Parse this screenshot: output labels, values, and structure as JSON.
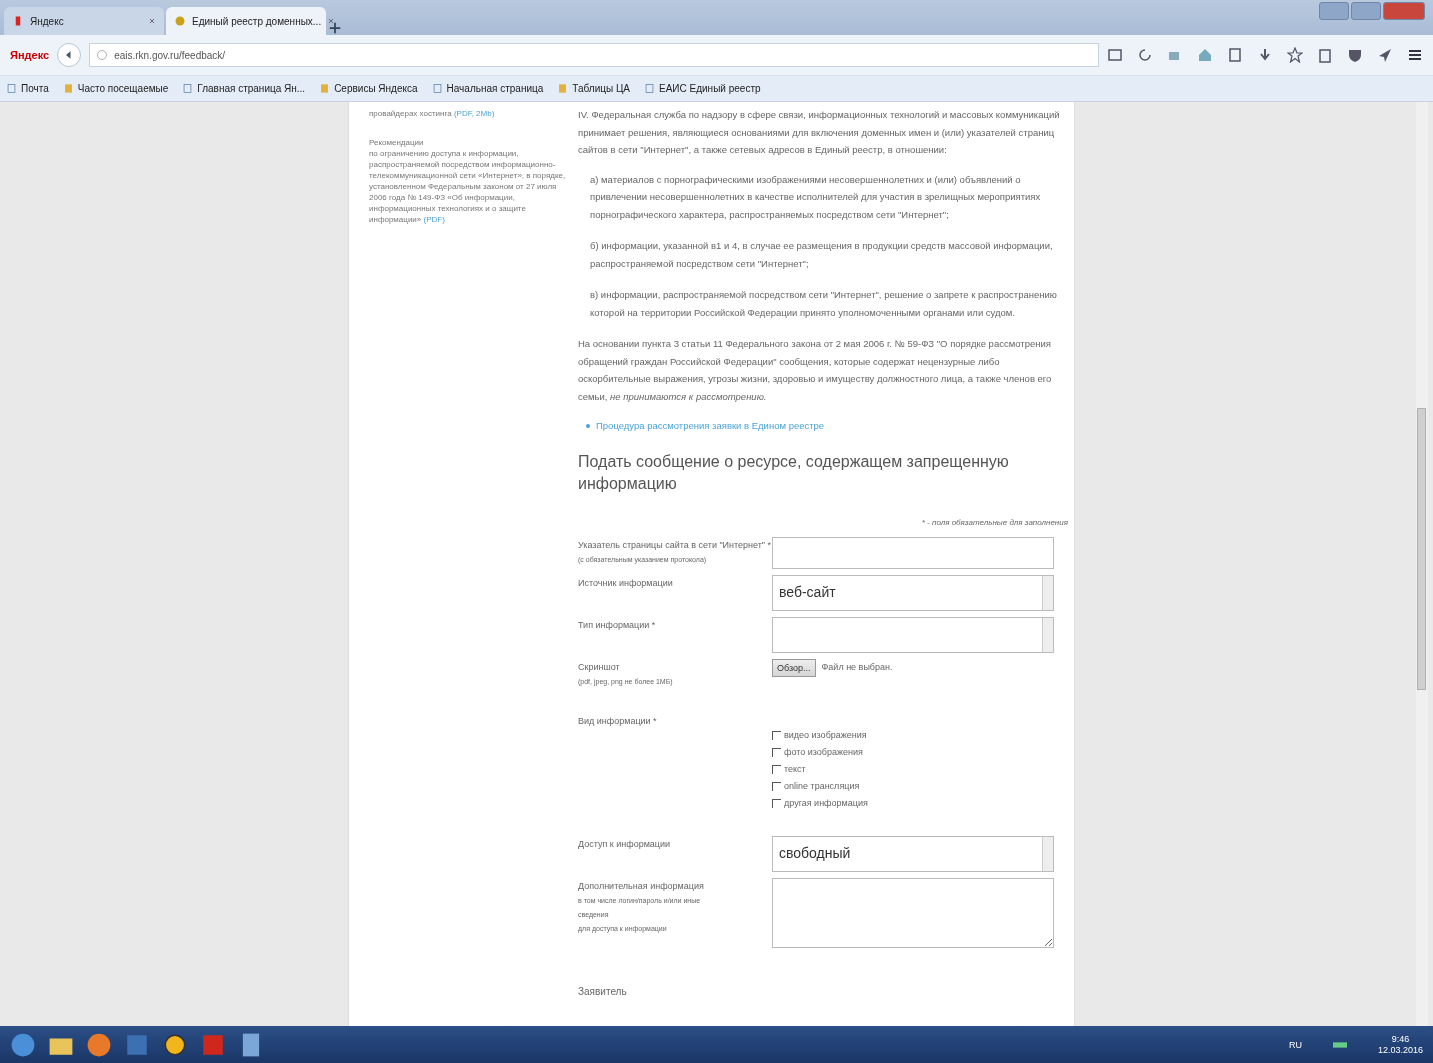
{
  "browser": {
    "tabs": [
      {
        "label": "Яндекс",
        "selected": false
      },
      {
        "label": "Единый реестр доменных...",
        "selected": true
      }
    ],
    "logo": "Яндекс",
    "url": "eais.rkn.gov.ru/feedback/",
    "bookmarks": [
      "Почта",
      "Часто посещаемые",
      "Главная страница Ян...",
      "Сервисы Яндекса",
      "Начальная страница",
      "Таблицы ЦА",
      "ЕАИС Единый реестр"
    ]
  },
  "sidebar": {
    "items": [
      {
        "text": "провайдерах хостинга ",
        "link": "(PDF, 2Mb)"
      },
      {
        "title": "Рекомендации",
        "text": "по ограничению доступа к информации, распространяемой посредством информационно-телекоммуникационной сети «Интернет», в порядке, установленном Федеральным законом от 27 июля 2006 года № 149-ФЗ «Об информации, информационных технологиях и о защите информации» ",
        "link": "(PDF)"
      }
    ]
  },
  "content": {
    "paragraphs": [
      {
        "kind": "intro",
        "text": "IV. Федеральная служба по надзору в сфере связи, информационных технологий и массовых коммуникаций принимает решения, являющиеся основаниями для включения доменных имен и (или) указателей страниц сайтов в сети \"Интернет\", а также сетевых адресов в Единый реестр, в отношении:"
      },
      {
        "kind": "item",
        "text": "а) материалов с порнографическими изображениями несовершеннолетних и (или) объявлений о привлечении несовершеннолетних в качестве исполнителей для участия в зрелищных мероприятиях порнографического характера, распространяемых посредством сети \"Интернет\";"
      },
      {
        "kind": "item",
        "text": "б) информации, указанной в1 и 4, в случае ее размещения в продукции средств массовой информации, распространяемой посредством сети \"Интернет\";"
      },
      {
        "kind": "item",
        "text": "в) информации, распространяемой посредством сети \"Интернет\", решение о запрете к распространению которой на территории Российской Федерации принято уполномоченными органами или судом."
      },
      {
        "kind": "note",
        "text": "На основании пункта 3 статьи 11 Федерального закона от 2 мая 2006 г. № 59-ФЗ \"О порядке рассмотрения обращений граждан Российской Федерации\" сообщения, которые содержат нецензурные либо оскорбительные выражения, угрозы жизни, здоровью и имуществу должностного лица, а также членов его семьи, *не принимаются к рассмотрению.*"
      }
    ],
    "link": "Процедура рассмотрения заявки в Едином реестре",
    "heading": "Подать сообщение о ресурсе, содержащем запрещенную информацию",
    "required_note": "* - поля обязательные для заполнения",
    "fields": [
      {
        "kind": "text",
        "label": "Указатель страницы сайта в сети \"Интернет\" *",
        "hint": "(с обязательным указанием протокола)"
      },
      {
        "kind": "select",
        "label": "Источник информации",
        "value": "веб-сайт"
      },
      {
        "kind": "select",
        "label": "Тип информации *"
      },
      {
        "kind": "file",
        "label": "Скриншот",
        "hint": "(pdf, jpeg, png не более 1МБ)",
        "button": "Обзор...",
        "status": "Файл не выбран."
      },
      {
        "kind": "checkboxes",
        "label": "Вид информации *",
        "options": [
          {
            "label": "видео изображения",
            "checked": false
          },
          {
            "label": "фото изображения",
            "checked": false
          },
          {
            "label": "текст",
            "checked": false
          },
          {
            "label": "online трансляция",
            "checked": false
          },
          {
            "label": "другая информация",
            "checked": false
          }
        ]
      },
      {
        "kind": "select",
        "label": "Доступ к информации",
        "value": "свободный"
      },
      {
        "kind": "textarea",
        "label": "Дополнительная информация",
        "hint_lines": [
          "в том числе логин/пароль и/или иные",
          "сведения",
          "для доступа к информации"
        ]
      }
    ],
    "next_section": "Заявитель"
  },
  "taskbar": {
    "language": "RU",
    "time": "9:46",
    "date": "12.03.2016"
  }
}
